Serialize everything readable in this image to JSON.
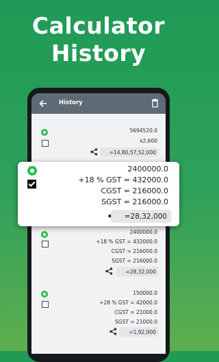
{
  "headline": {
    "line1": "Calculator",
    "line2": "History"
  },
  "appbar": {
    "title": "History",
    "back_icon": "arrow-back-icon",
    "delete_icon": "trash-icon"
  },
  "entries": [
    {
      "lines": [
        "5694520.0",
        "x2,600"
      ],
      "result": "=14,80,57,52,000"
    },
    {
      "lines": [
        "2400000.0",
        "+18 % GST = 432000.0",
        "CGST = 216000.0",
        "SGST = 216000.0"
      ],
      "result": "=28,32,000"
    },
    {
      "lines": [
        "150000.0",
        "+28 % GST = 42000.0",
        "CGST = 21000.0",
        "SGST = 21000.0"
      ],
      "result": "=1,92,000"
    }
  ],
  "popup": {
    "lines": [
      "2400000.0",
      "+18 % GST = 432000.0",
      "CGST = 216000.0",
      "SGST = 216000.0"
    ],
    "result": "=28,32,000",
    "checked": true
  },
  "colors": {
    "accent": "#2fa15a",
    "appbar": "#5e6a74",
    "whatsapp": "#2ebd4f"
  }
}
